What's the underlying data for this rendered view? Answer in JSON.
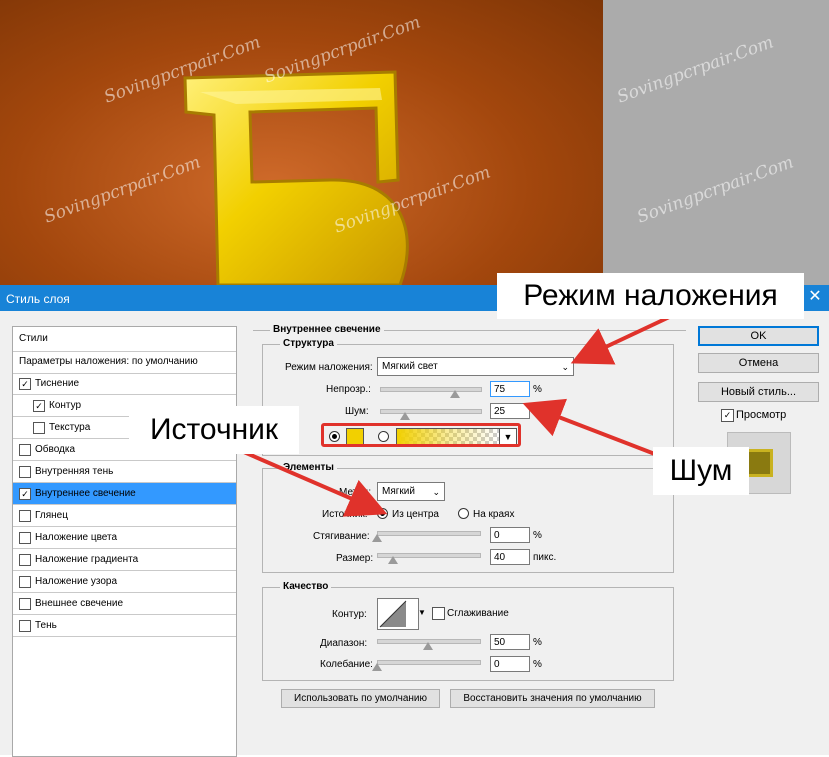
{
  "window": {
    "title": "Стиль слоя",
    "close_glyph": "✕"
  },
  "canvas_letter": "Б",
  "watermark_text": "Sovingpcrpair.Com",
  "styles_list": {
    "header": "Стили",
    "blend_defaults": "Параметры наложения: по умолчанию",
    "items": [
      {
        "label": "Тиснение",
        "checked": true,
        "indent": false,
        "selected": false
      },
      {
        "label": "Контур",
        "checked": true,
        "indent": true,
        "selected": false
      },
      {
        "label": "Текстура",
        "checked": false,
        "indent": true,
        "selected": false
      },
      {
        "label": "Обводка",
        "checked": false,
        "indent": false,
        "selected": false
      },
      {
        "label": "Внутренняя тень",
        "checked": false,
        "indent": false,
        "selected": false
      },
      {
        "label": "Внутреннее свечение",
        "checked": true,
        "indent": false,
        "selected": true
      },
      {
        "label": "Глянец",
        "checked": false,
        "indent": false,
        "selected": false
      },
      {
        "label": "Наложение цвета",
        "checked": false,
        "indent": false,
        "selected": false
      },
      {
        "label": "Наложение градиента",
        "checked": false,
        "indent": false,
        "selected": false
      },
      {
        "label": "Наложение узора",
        "checked": false,
        "indent": false,
        "selected": false
      },
      {
        "label": "Внешнее свечение",
        "checked": false,
        "indent": false,
        "selected": false
      },
      {
        "label": "Тень",
        "checked": false,
        "indent": false,
        "selected": false
      }
    ]
  },
  "panel": {
    "title": "Внутреннее свечение",
    "structure": {
      "title": "Структура",
      "blend_mode_label": "Режим наложения:",
      "blend_mode_value": "Мягкий свет",
      "opacity_label": "Непрозр.:",
      "opacity_value": "75",
      "opacity_unit": "%",
      "opacity_level": 0.75,
      "noise_label": "Шум:",
      "noise_value": "25",
      "noise_level": 0.25
    },
    "elements": {
      "title": "Элементы",
      "method_label": "Метод:",
      "method_value": "Мягкий",
      "source_label": "Источник:",
      "source_center": "Из центра",
      "source_edge": "На краях",
      "choke_label": "Стягивание:",
      "choke_value": "0",
      "choke_unit": "%",
      "choke_level": 0,
      "size_label": "Размер:",
      "size_value": "40",
      "size_unit": "пикс.",
      "size_level": 0.16
    },
    "quality": {
      "title": "Качество",
      "contour_label": "Контур:",
      "antialias_label": "Сглаживание",
      "range_label": "Диапазон:",
      "range_value": "50",
      "range_unit": "%",
      "range_level": 0.5,
      "jitter_label": "Колебание:",
      "jitter_value": "0",
      "jitter_unit": "%",
      "jitter_level": 0
    },
    "make_default": "Использовать по умолчанию",
    "reset_default": "Восстановить значения по умолчанию"
  },
  "right": {
    "ok": "OK",
    "cancel": "Отмена",
    "new_style": "Новый стиль...",
    "preview": "Просмотр"
  },
  "callouts": {
    "blend_mode": "Режим наложения",
    "source": "Источник",
    "noise": "Шум"
  },
  "colors": {
    "canvas_orange": "#a3470d",
    "letter_yellow": "#f2d000",
    "titlebar_blue": "#1883d7",
    "selection_blue": "#3399ff",
    "annotation_red": "#e0322b"
  }
}
